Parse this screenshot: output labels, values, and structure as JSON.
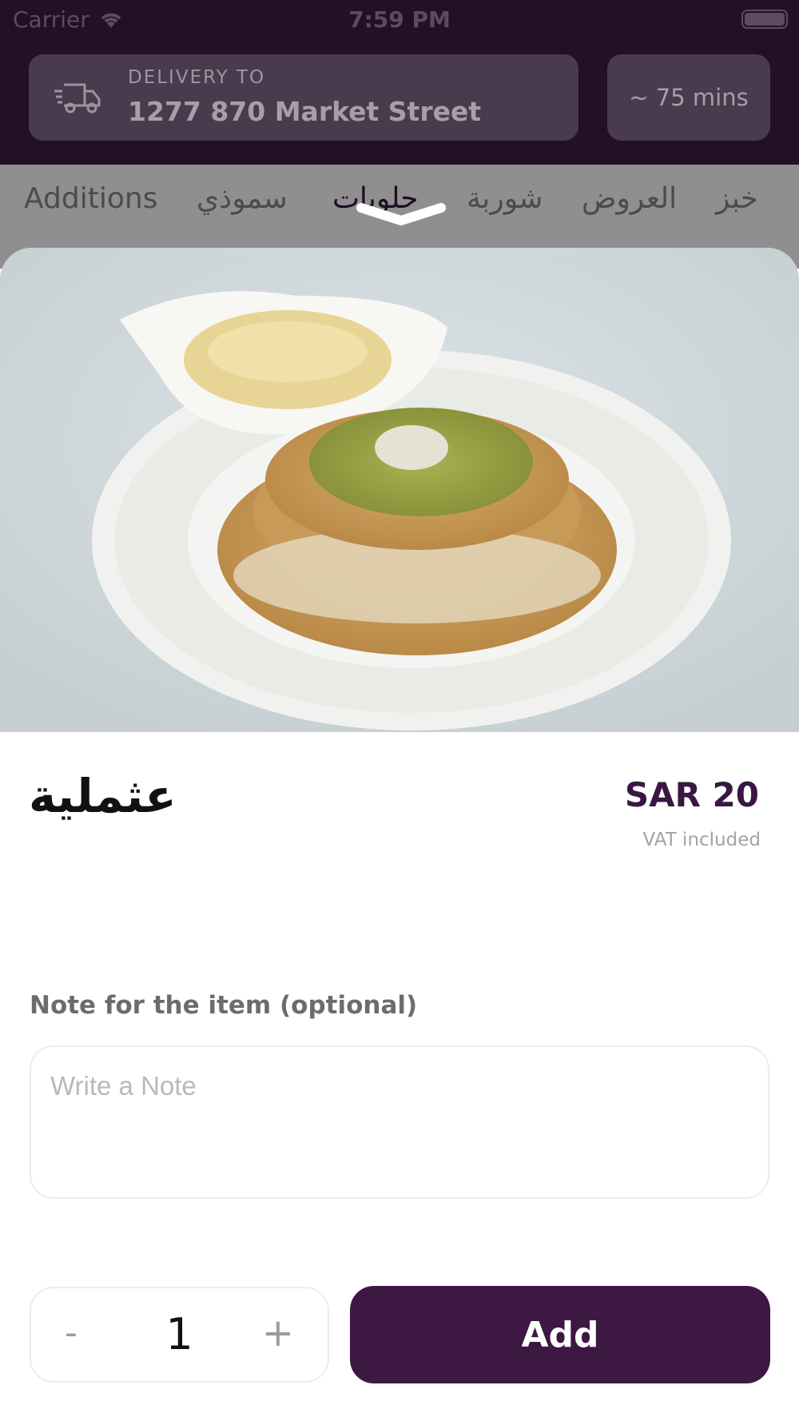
{
  "status_bar": {
    "carrier": "Carrier",
    "time": "7:59 PM"
  },
  "header": {
    "delivery_label": "DELIVERY TO",
    "delivery_address": "1277 870 Market Street",
    "eta": "~ 75 mins",
    "colors": {
      "background": "#231026",
      "box": "#4a3a4d"
    }
  },
  "tabs": [
    {
      "label": "Additions"
    },
    {
      "label": "سموذي"
    },
    {
      "label": "حلويات",
      "active": true
    },
    {
      "label": "شوربة"
    },
    {
      "label": "العروض"
    },
    {
      "label": "خبز"
    }
  ],
  "item": {
    "image_icon": "kunafa-dessert-photo",
    "title": "عثملية",
    "price": "SAR 20",
    "vat_note": "VAT included"
  },
  "note": {
    "label": "Note for the item (optional)",
    "placeholder": "Write a Note",
    "value": ""
  },
  "quantity": {
    "minus": "-",
    "value": "1",
    "plus": "+"
  },
  "actions": {
    "add_label": "Add",
    "accent_color": "#3d1842"
  }
}
